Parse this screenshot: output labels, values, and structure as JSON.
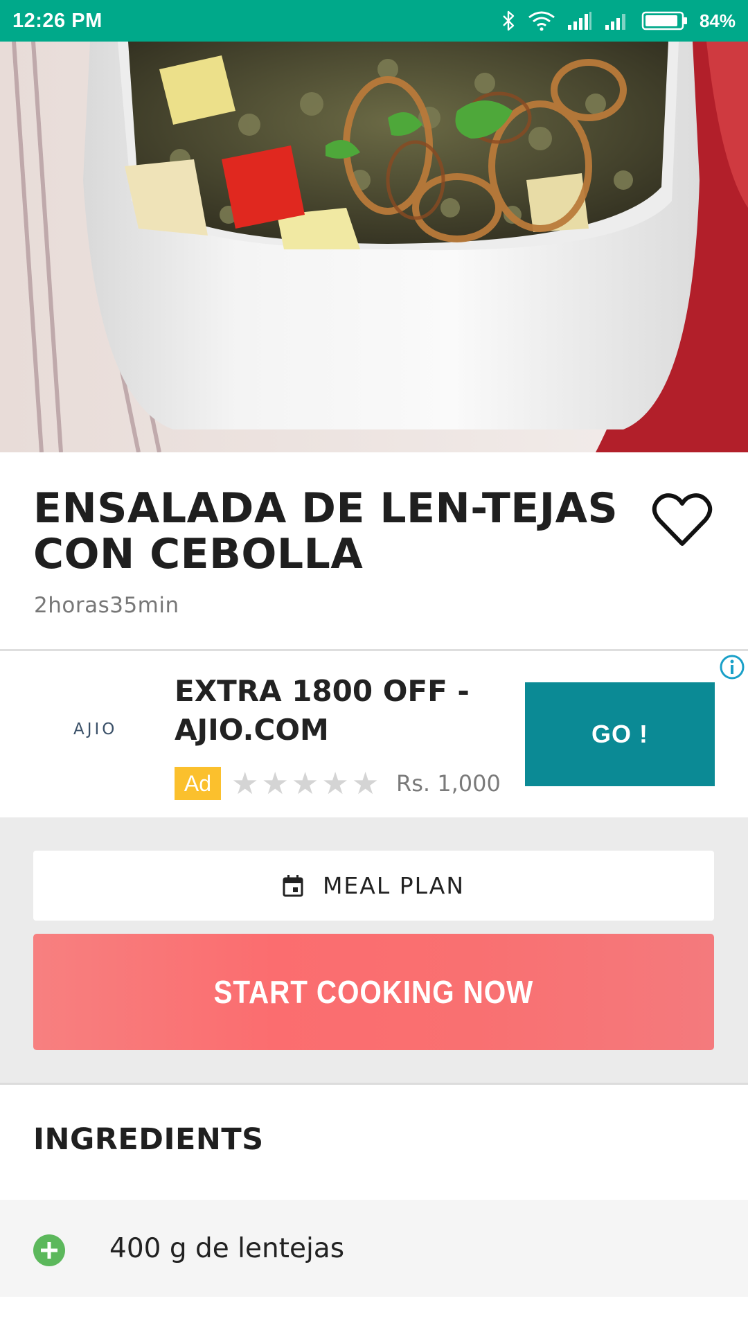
{
  "status_bar": {
    "time": "12:26 PM",
    "battery": "84%",
    "icons": [
      "bluetooth-icon",
      "wifi-icon",
      "signal-icon",
      "signal-icon",
      "battery-icon"
    ]
  },
  "recipe": {
    "title": "ENSALADA DE LEN-TEJAS CON CEBOLLA",
    "time": "2horas35min",
    "image": "lentil-salad-photo"
  },
  "ad": {
    "brand": "AJIO",
    "headline": "EXTRA 1800 OFF - AJIO.COM",
    "badge": "Ad",
    "rating": 0,
    "price": "Rs. 1,000",
    "cta": "GO !"
  },
  "actions": {
    "meal_plan_label": "MEAL PLAN",
    "start_cooking_label": "START COOKING NOW"
  },
  "ingredients": {
    "heading": "INGREDIENTS",
    "items": [
      "400 g de lentejas"
    ]
  },
  "colors": {
    "status_bar": "#00a98a",
    "cook_button": "#fb6d6f",
    "ad_cta": "#0b8a95",
    "ad_badge": "#fbc02d",
    "add_icon": "#5cb85c"
  }
}
